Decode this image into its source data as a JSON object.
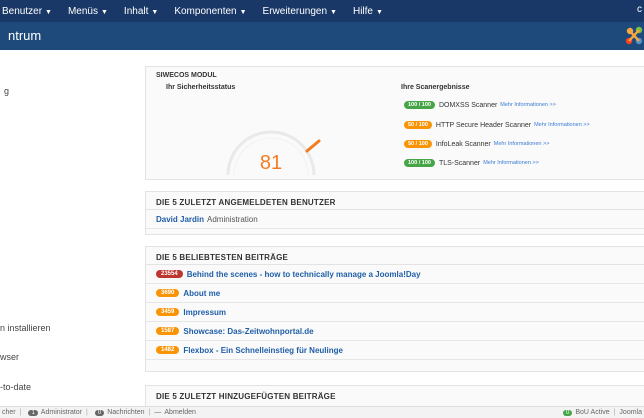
{
  "nav": {
    "items": [
      "Benutzer",
      "Menüs",
      "Inhalt",
      "Komponenten",
      "Erweiterungen",
      "Hilfe"
    ],
    "right_letter": "c"
  },
  "header": {
    "title": "ntrum"
  },
  "sidebar": {
    "items": [
      "g",
      "n installieren",
      "wser",
      "-to-date"
    ]
  },
  "siwecos": {
    "title": "SIWECOS MODUL",
    "status_label": "Ihr Sicherheitsstatus",
    "score": "81",
    "results_label": "Ihre Scanergebnisse",
    "results": [
      {
        "score": "100 / 100",
        "name": "DOMXSS Scanner",
        "more": "Mehr Informationen >>",
        "color": "#46a546"
      },
      {
        "score": "50 / 100",
        "name": "HTTP Secure Header Scanner",
        "more": "Mehr Informationen >>",
        "color": "#f89406"
      },
      {
        "score": "50 / 100",
        "name": "InfoLeak Scanner",
        "more": "Mehr Informationen >>",
        "color": "#f89406"
      },
      {
        "score": "100 / 100",
        "name": "TLS-Scanner",
        "more": "Mehr Informationen >>",
        "color": "#46a546"
      }
    ]
  },
  "logged_in": {
    "title": "DIE 5 ZULETZT ANGEMELDETEN BENUTZER",
    "users": [
      {
        "name": "David Jardin",
        "role": "Administration"
      }
    ]
  },
  "popular": {
    "title": "DIE 5 BELIEBTESTEN BEITRÄGE",
    "items": [
      {
        "hits": "23554",
        "title": "Behind the scenes - how to technically manage a Joomla!Day",
        "color": "#bd362f"
      },
      {
        "hits": "3690",
        "title": "About me",
        "color": "#f89406"
      },
      {
        "hits": "3459",
        "title": "Impressum",
        "color": "#f89406"
      },
      {
        "hits": "1587",
        "title": "Showcase: Das-Zeitwohnportal.de",
        "color": "#f89406"
      },
      {
        "hits": "1482",
        "title": "Flexbox - Ein Schnelleinstieg für Neulinge",
        "color": "#f89406"
      }
    ]
  },
  "recent": {
    "title": "DIE 5 ZULETZT HINZUGEFÜGTEN BEITRÄGE"
  },
  "footer": {
    "left_text": "cher",
    "admin_count": "1",
    "admin_label": "Administrator",
    "msg_count": "0",
    "msg_label": "Nachrichten",
    "logout_label": "Abmelden",
    "bou_count": "0",
    "bou_label": "BoU Active",
    "joomla_label": "Joomla"
  }
}
